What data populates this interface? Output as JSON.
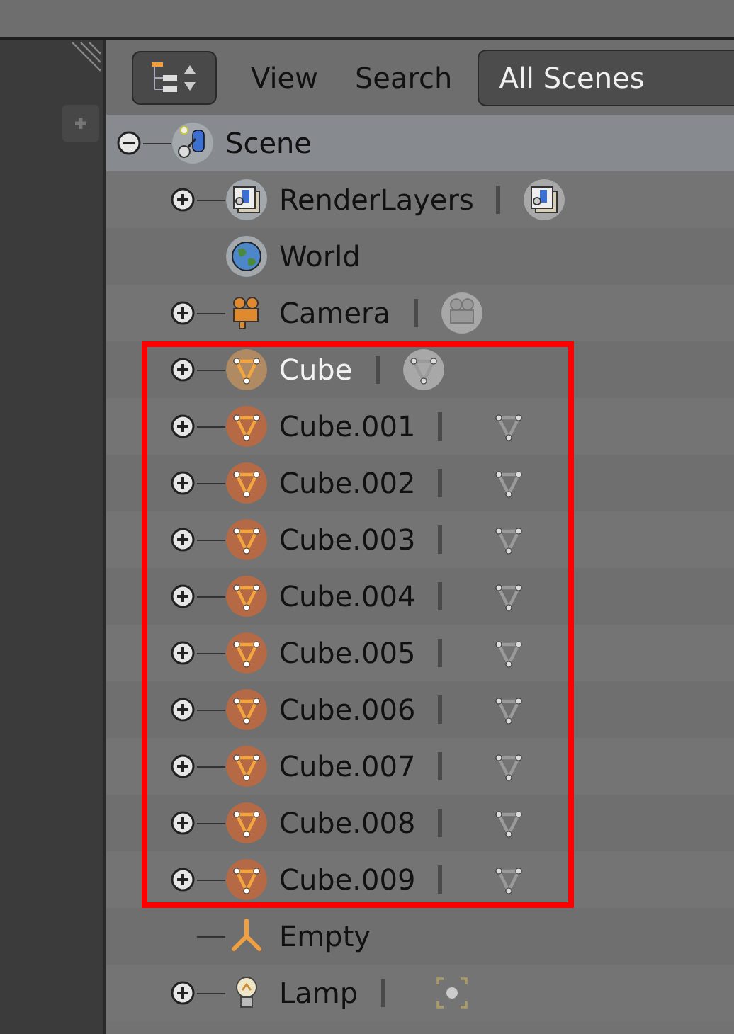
{
  "header": {
    "view_menu": "View",
    "search_menu": "Search",
    "scene_filter": "All Scenes"
  },
  "tree": {
    "kind": "scene",
    "label": "Scene",
    "expanded": true,
    "selected": true,
    "children": [
      {
        "kind": "render_layers",
        "label": "RenderLayers",
        "expanded": false,
        "selected": true,
        "data_icon": true,
        "active": false,
        "framed": false
      },
      {
        "kind": "world",
        "label": "World",
        "selected": true,
        "data_icon": false,
        "active": false,
        "framed": false
      },
      {
        "kind": "camera",
        "label": "Camera",
        "expanded": false,
        "selected": false,
        "data_icon": true,
        "active": false,
        "framed": false
      },
      {
        "kind": "mesh",
        "label": "Cube",
        "expanded": false,
        "selected": true,
        "data_icon": true,
        "active": true,
        "framed": true
      },
      {
        "kind": "mesh",
        "label": "Cube.001",
        "expanded": false,
        "selected": true,
        "data_icon": true,
        "active": false,
        "framed": true
      },
      {
        "kind": "mesh",
        "label": "Cube.002",
        "expanded": false,
        "selected": true,
        "data_icon": true,
        "active": false,
        "framed": true
      },
      {
        "kind": "mesh",
        "label": "Cube.003",
        "expanded": false,
        "selected": true,
        "data_icon": true,
        "active": false,
        "framed": true
      },
      {
        "kind": "mesh",
        "label": "Cube.004",
        "expanded": false,
        "selected": true,
        "data_icon": true,
        "active": false,
        "framed": true
      },
      {
        "kind": "mesh",
        "label": "Cube.005",
        "expanded": false,
        "selected": true,
        "data_icon": true,
        "active": false,
        "framed": true
      },
      {
        "kind": "mesh",
        "label": "Cube.006",
        "expanded": false,
        "selected": true,
        "data_icon": true,
        "active": false,
        "framed": true
      },
      {
        "kind": "mesh",
        "label": "Cube.007",
        "expanded": false,
        "selected": true,
        "data_icon": true,
        "active": false,
        "framed": true
      },
      {
        "kind": "mesh",
        "label": "Cube.008",
        "expanded": false,
        "selected": true,
        "data_icon": true,
        "active": false,
        "framed": true
      },
      {
        "kind": "mesh",
        "label": "Cube.009",
        "expanded": false,
        "selected": true,
        "data_icon": true,
        "active": false,
        "framed": true
      },
      {
        "kind": "empty",
        "label": "Empty",
        "selected": false,
        "data_icon": false,
        "active": false,
        "framed": false
      },
      {
        "kind": "lamp",
        "label": "Lamp",
        "expanded": false,
        "selected": false,
        "data_icon": true,
        "active": false,
        "framed": false
      }
    ]
  }
}
